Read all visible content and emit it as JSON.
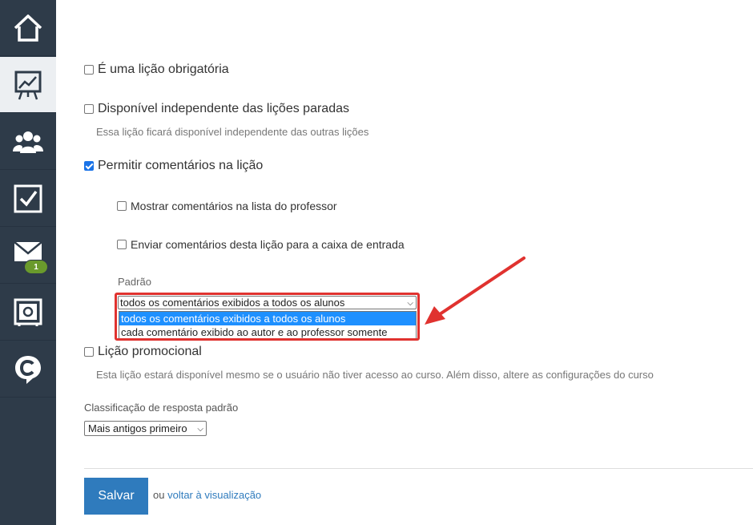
{
  "sidebar": {
    "items": [
      {
        "icon": "home-icon"
      },
      {
        "icon": "presentation-chart-icon",
        "active": true
      },
      {
        "icon": "users-icon"
      },
      {
        "icon": "checkbox-icon"
      },
      {
        "icon": "mail-icon",
        "badge": "1"
      },
      {
        "icon": "safe-icon"
      },
      {
        "icon": "chat-c-icon"
      }
    ]
  },
  "form": {
    "mandatory": {
      "label": "É uma lição obrigatória",
      "checked": false
    },
    "independent": {
      "label": "Disponível independente das lições paradas",
      "checked": false,
      "hint": "Essa lição ficará disponível independente das outras lições"
    },
    "allow_comments": {
      "label": "Permitir comentários na lição",
      "checked": true
    },
    "show_comments": {
      "label": "Mostrar comentários na lista do professor",
      "checked": false
    },
    "send_comments": {
      "label": "Enviar comentários desta lição para a caixa de entrada",
      "checked": false
    },
    "default_label": "Padrão",
    "default_select": {
      "value": "todos os comentários exibidos a todos os alunos",
      "options": [
        "todos os comentários exibidos a todos os alunos",
        "cada comentário exibido ao autor e ao professor somente"
      ]
    },
    "promo": {
      "label": "Lição promocional",
      "checked": false,
      "hint": "Esta lição estará disponível mesmo se o usuário não tiver acesso ao curso. Além disso, altere as configurações do curso"
    },
    "sort_label": "Classificação de resposta padrão",
    "sort_select": {
      "value": "Mais antigos primeiro"
    }
  },
  "footer": {
    "save_label": "Salvar",
    "or_text": "ou",
    "back_link": "voltar à visualização"
  },
  "colors": {
    "sidebar": "#2e3b49",
    "accent": "#2f7bbd",
    "highlight": "#e0322f",
    "badge": "#6a9a2c"
  }
}
